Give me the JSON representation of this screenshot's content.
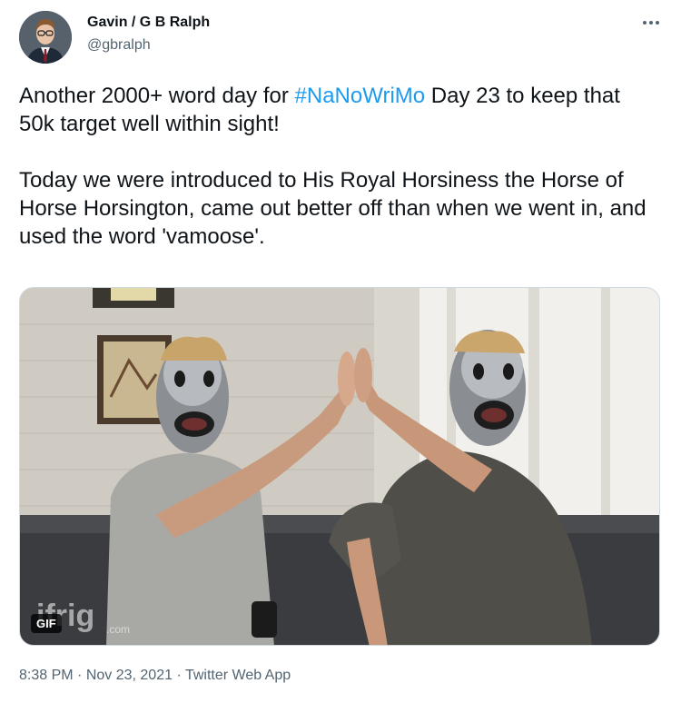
{
  "author": {
    "name": "Gavin / G B Ralph",
    "handle": "@gbralph"
  },
  "more_icon": "more-horizontal-icon",
  "tweet": {
    "line1_before": "Another 2000+ word day for ",
    "hashtag": "#NaNoWriMo",
    "line1_after": " Day 23 to keep that 50k target well within sight!",
    "paragraph2": "Today we were introduced to His Royal Horsiness the Horse of Horse Horsington, came out better off than when we went in, and used the word 'vamoose'."
  },
  "media": {
    "badge": "GIF",
    "watermark": "ifrig.com"
  },
  "meta": {
    "time": "8:38 PM",
    "separator": " · ",
    "date": "Nov 23, 2021",
    "source": "Twitter Web App"
  },
  "colors": {
    "link": "#1d9bf0",
    "secondary": "#536471",
    "text": "#0f1419"
  }
}
